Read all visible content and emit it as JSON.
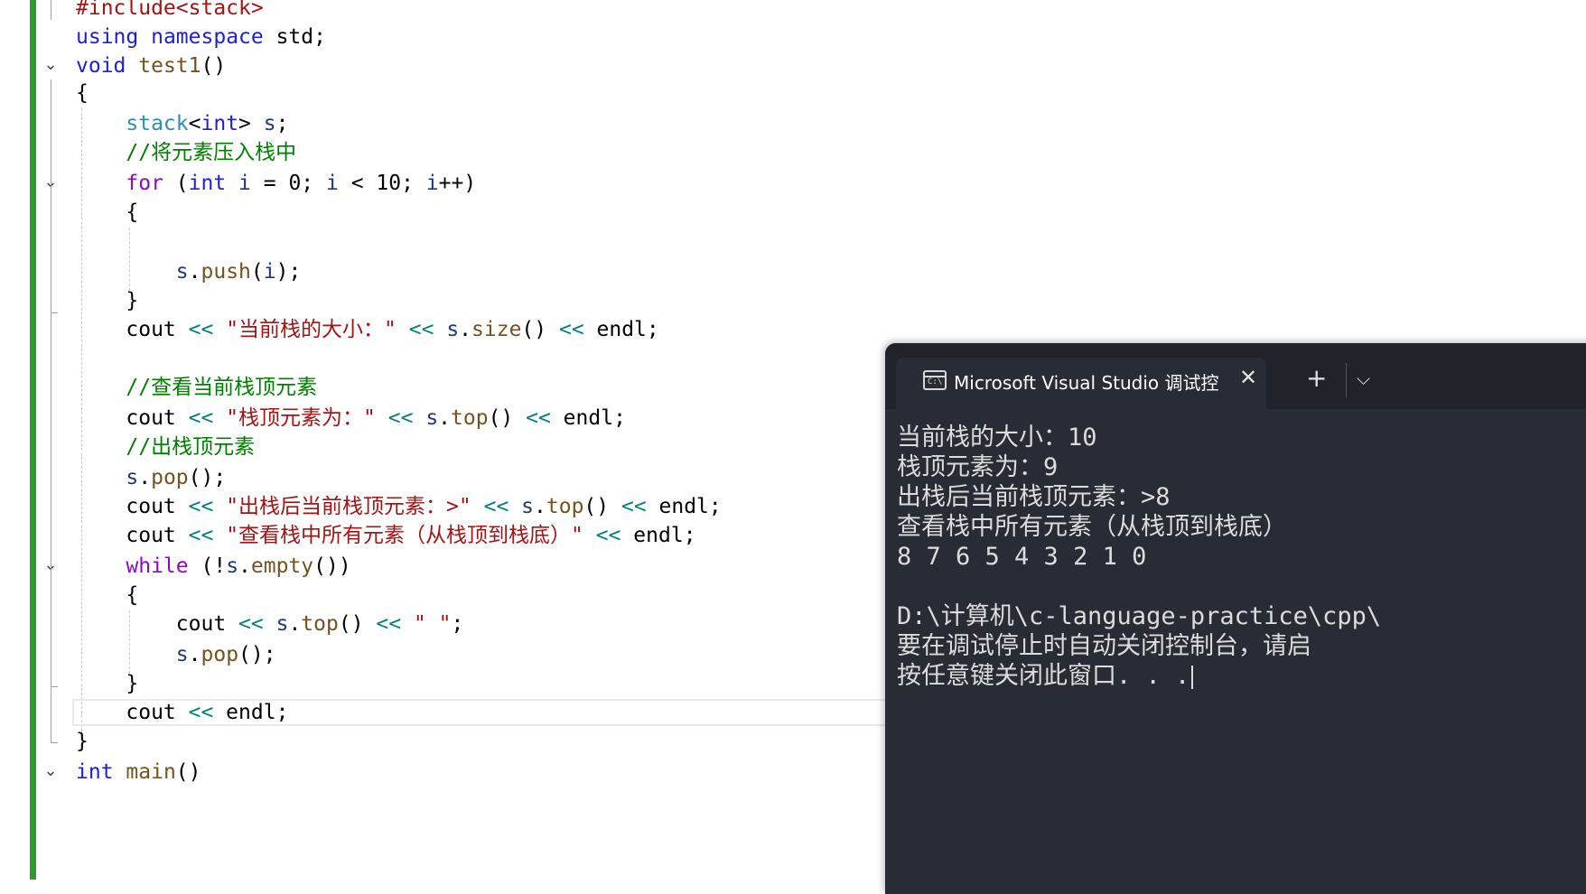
{
  "editor": {
    "lines": [
      {
        "segments": [
          {
            "t": "#include<stack>",
            "c": "str"
          }
        ]
      },
      {
        "segments": [
          {
            "t": "using",
            "c": "kw"
          },
          {
            "t": " "
          },
          {
            "t": "namespace",
            "c": "kw"
          },
          {
            "t": " std;"
          }
        ]
      },
      {
        "segments": [
          {
            "t": "void",
            "c": "kw"
          },
          {
            "t": " "
          },
          {
            "t": "test1",
            "c": "fn"
          },
          {
            "t": "()"
          }
        ]
      },
      {
        "segments": [
          {
            "t": "{"
          }
        ]
      },
      {
        "segments": [
          {
            "t": "    "
          },
          {
            "t": "stack",
            "c": "ty"
          },
          {
            "t": "<"
          },
          {
            "t": "int",
            "c": "kw"
          },
          {
            "t": "> "
          },
          {
            "t": "s",
            "c": "mem"
          },
          {
            "t": ";"
          }
        ]
      },
      {
        "segments": [
          {
            "t": "    "
          },
          {
            "t": "//将元素压入栈中",
            "c": "cm"
          }
        ]
      },
      {
        "segments": [
          {
            "t": "    "
          },
          {
            "t": "for",
            "c": "ctrl"
          },
          {
            "t": " ("
          },
          {
            "t": "int",
            "c": "kw"
          },
          {
            "t": " "
          },
          {
            "t": "i",
            "c": "mem"
          },
          {
            "t": " = 0; "
          },
          {
            "t": "i",
            "c": "mem"
          },
          {
            "t": " < 10; "
          },
          {
            "t": "i",
            "c": "mem"
          },
          {
            "t": "++)"
          }
        ]
      },
      {
        "segments": [
          {
            "t": "    {"
          }
        ]
      },
      {
        "segments": [
          {
            "t": ""
          }
        ]
      },
      {
        "segments": [
          {
            "t": "        "
          },
          {
            "t": "s",
            "c": "mem"
          },
          {
            "t": "."
          },
          {
            "t": "push",
            "c": "fn"
          },
          {
            "t": "("
          },
          {
            "t": "i",
            "c": "mem"
          },
          {
            "t": ");"
          }
        ]
      },
      {
        "segments": [
          {
            "t": "    }"
          }
        ]
      },
      {
        "segments": [
          {
            "t": "    cout "
          },
          {
            "t": "<<",
            "c": "op"
          },
          {
            "t": " "
          },
          {
            "t": "\"当前栈的大小：\"",
            "c": "str"
          },
          {
            "t": " "
          },
          {
            "t": "<<",
            "c": "op"
          },
          {
            "t": " "
          },
          {
            "t": "s",
            "c": "mem"
          },
          {
            "t": "."
          },
          {
            "t": "size",
            "c": "fn"
          },
          {
            "t": "() "
          },
          {
            "t": "<<",
            "c": "op"
          },
          {
            "t": " endl;"
          }
        ]
      },
      {
        "segments": [
          {
            "t": ""
          }
        ]
      },
      {
        "segments": [
          {
            "t": "    "
          },
          {
            "t": "//查看当前栈顶元素",
            "c": "cm"
          }
        ]
      },
      {
        "segments": [
          {
            "t": "    cout "
          },
          {
            "t": "<<",
            "c": "op"
          },
          {
            "t": " "
          },
          {
            "t": "\"栈顶元素为：\"",
            "c": "str"
          },
          {
            "t": " "
          },
          {
            "t": "<<",
            "c": "op"
          },
          {
            "t": " "
          },
          {
            "t": "s",
            "c": "mem"
          },
          {
            "t": "."
          },
          {
            "t": "top",
            "c": "fn"
          },
          {
            "t": "() "
          },
          {
            "t": "<<",
            "c": "op"
          },
          {
            "t": " endl;"
          }
        ]
      },
      {
        "segments": [
          {
            "t": "    "
          },
          {
            "t": "//出栈顶元素",
            "c": "cm"
          }
        ]
      },
      {
        "segments": [
          {
            "t": "    "
          },
          {
            "t": "s",
            "c": "mem"
          },
          {
            "t": "."
          },
          {
            "t": "pop",
            "c": "fn"
          },
          {
            "t": "();"
          }
        ]
      },
      {
        "segments": [
          {
            "t": "    cout "
          },
          {
            "t": "<<",
            "c": "op"
          },
          {
            "t": " "
          },
          {
            "t": "\"出栈后当前栈顶元素：>\"",
            "c": "str"
          },
          {
            "t": " "
          },
          {
            "t": "<<",
            "c": "op"
          },
          {
            "t": " "
          },
          {
            "t": "s",
            "c": "mem"
          },
          {
            "t": "."
          },
          {
            "t": "top",
            "c": "fn"
          },
          {
            "t": "() "
          },
          {
            "t": "<<",
            "c": "op"
          },
          {
            "t": " endl;"
          }
        ]
      },
      {
        "segments": [
          {
            "t": "    cout "
          },
          {
            "t": "<<",
            "c": "op"
          },
          {
            "t": " "
          },
          {
            "t": "\"查看栈中所有元素（从栈顶到栈底）\"",
            "c": "str"
          },
          {
            "t": " "
          },
          {
            "t": "<<",
            "c": "op"
          },
          {
            "t": " endl;"
          }
        ]
      },
      {
        "segments": [
          {
            "t": "    "
          },
          {
            "t": "while",
            "c": "ctrl"
          },
          {
            "t": " (!"
          },
          {
            "t": "s",
            "c": "mem"
          },
          {
            "t": "."
          },
          {
            "t": "empty",
            "c": "fn"
          },
          {
            "t": "())"
          }
        ]
      },
      {
        "segments": [
          {
            "t": "    {"
          }
        ]
      },
      {
        "segments": [
          {
            "t": "        cout "
          },
          {
            "t": "<<",
            "c": "op"
          },
          {
            "t": " "
          },
          {
            "t": "s",
            "c": "mem"
          },
          {
            "t": "."
          },
          {
            "t": "top",
            "c": "fn"
          },
          {
            "t": "() "
          },
          {
            "t": "<<",
            "c": "op"
          },
          {
            "t": " "
          },
          {
            "t": "\" \"",
            "c": "str"
          },
          {
            "t": ";"
          }
        ]
      },
      {
        "segments": [
          {
            "t": "        "
          },
          {
            "t": "s",
            "c": "mem"
          },
          {
            "t": "."
          },
          {
            "t": "pop",
            "c": "fn"
          },
          {
            "t": "();"
          }
        ]
      },
      {
        "segments": [
          {
            "t": "    }"
          }
        ]
      },
      {
        "segments": [
          {
            "t": "    cout "
          },
          {
            "t": "<<",
            "c": "op"
          },
          {
            "t": " endl;"
          }
        ]
      },
      {
        "segments": [
          {
            "t": "}"
          }
        ]
      },
      {
        "segments": [
          {
            "t": "int",
            "c": "kw"
          },
          {
            "t": " "
          },
          {
            "t": "main",
            "c": "fn"
          },
          {
            "t": "()"
          }
        ]
      }
    ]
  },
  "terminal": {
    "tab_icon_text": "C:\\",
    "tab_title": "Microsoft Visual Studio 调试控",
    "close_glyph": "✕",
    "new_tab_glyph": "+",
    "dropdown_glyph": "⌵",
    "output": [
      "当前栈的大小：10",
      "栈顶元素为：9",
      "出栈后当前栈顶元素：>8",
      "查看栈中所有元素（从栈顶到栈底）",
      "8 7 6 5 4 3 2 1 0",
      "",
      "D:\\计算机\\c-language-practice\\cpp\\",
      "要在调试停止时自动关闭控制台，请启",
      "按任意键关闭此窗口. . ."
    ]
  },
  "colors": {
    "keyword": "#1f1fd6",
    "type": "#2b91af",
    "string": "#a31515",
    "comment": "#008000",
    "control": "#8f08c4",
    "terminal_bg": "#282c34",
    "change_bar": "#2e9b2e"
  },
  "icons": {
    "fold": "chevron-down-icon",
    "terminal": "console-icon",
    "close": "close-icon",
    "add": "plus-icon",
    "dropdown": "chevron-down-icon"
  }
}
